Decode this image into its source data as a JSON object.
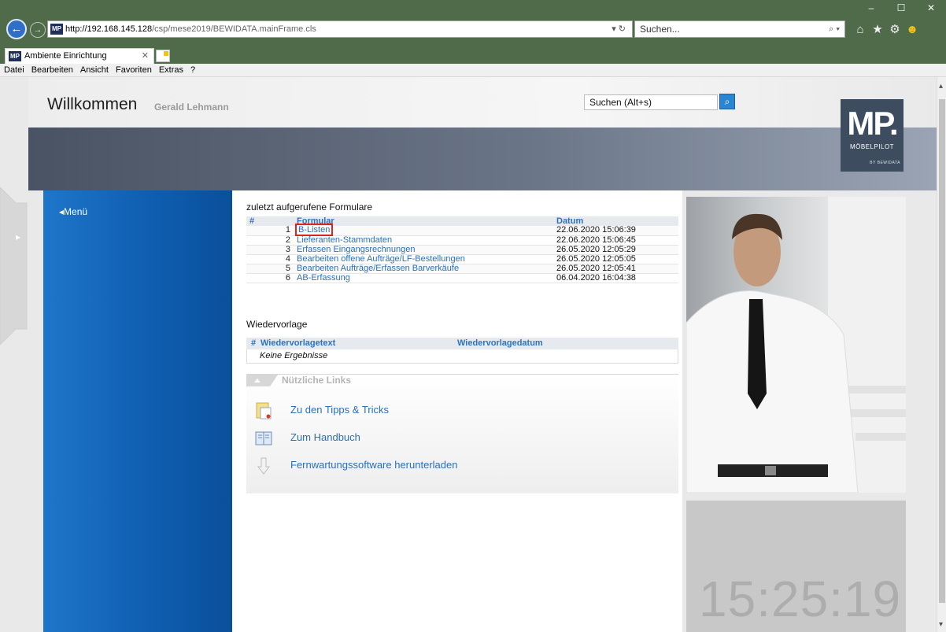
{
  "browser": {
    "url_host": "http://192.168.145.128",
    "url_path": "/csp/mese2019/BEWIDATA.mainFrame.cls",
    "search_placeholder": "Suchen...",
    "tab_title": "Ambiente Einrichtung",
    "favicon_text": "MP",
    "menu": [
      "Datei",
      "Bearbeiten",
      "Ansicht",
      "Favoriten",
      "Extras",
      "?"
    ]
  },
  "header": {
    "welcome": "Willkommen",
    "user": "Gerald Lehmann",
    "search_placeholder": "Suchen (Alt+s)"
  },
  "logo": {
    "mark": "MP.",
    "name": "MÖBELPILOT",
    "sub": "BY BEWIDATA"
  },
  "sidebar": {
    "menu_label": "◂Menü"
  },
  "recent": {
    "title": "zuletzt aufgerufene Formulare",
    "columns": [
      "#",
      "Formular",
      "Datum"
    ],
    "rows": [
      {
        "num": "1",
        "form": "B-Listen",
        "date": "22.06.2020 15:06:39"
      },
      {
        "num": "2",
        "form": "Lieferanten-Stammdaten",
        "date": "22.06.2020 15:06:45"
      },
      {
        "num": "3",
        "form": "Erfassen Eingangsrechnungen",
        "date": "26.05.2020 12:05:29"
      },
      {
        "num": "4",
        "form": "Bearbeiten offene Aufträge/LF-Bestellungen",
        "date": "26.05.2020 12:05:05"
      },
      {
        "num": "5",
        "form": "Bearbeiten Aufträge/Erfassen Barverkäufe",
        "date": "26.05.2020 12:05:41"
      },
      {
        "num": "6",
        "form": "AB-Erfassung",
        "date": "06.04.2020 16:04:38"
      }
    ]
  },
  "wiedervorlage": {
    "title": "Wiedervorlage",
    "col_num": "#",
    "col_text": "Wiedervorlagetext",
    "col_date": "Wiedervorlagedatum",
    "empty": "Keine Ergebnisse"
  },
  "links": {
    "title": "Nützliche Links",
    "items": [
      {
        "label": "Zu den Tipps & Tricks",
        "icon": "document-icon"
      },
      {
        "label": "Zum Handbuch",
        "icon": "book-icon"
      },
      {
        "label": "Fernwartungssoftware herunterladen",
        "icon": "download-icon"
      }
    ]
  },
  "clock": {
    "time": "15:25:19"
  },
  "colors": {
    "accent_blue": "#1f76c9",
    "link_blue": "#2a6fba",
    "highlight_red": "#d7261e"
  }
}
